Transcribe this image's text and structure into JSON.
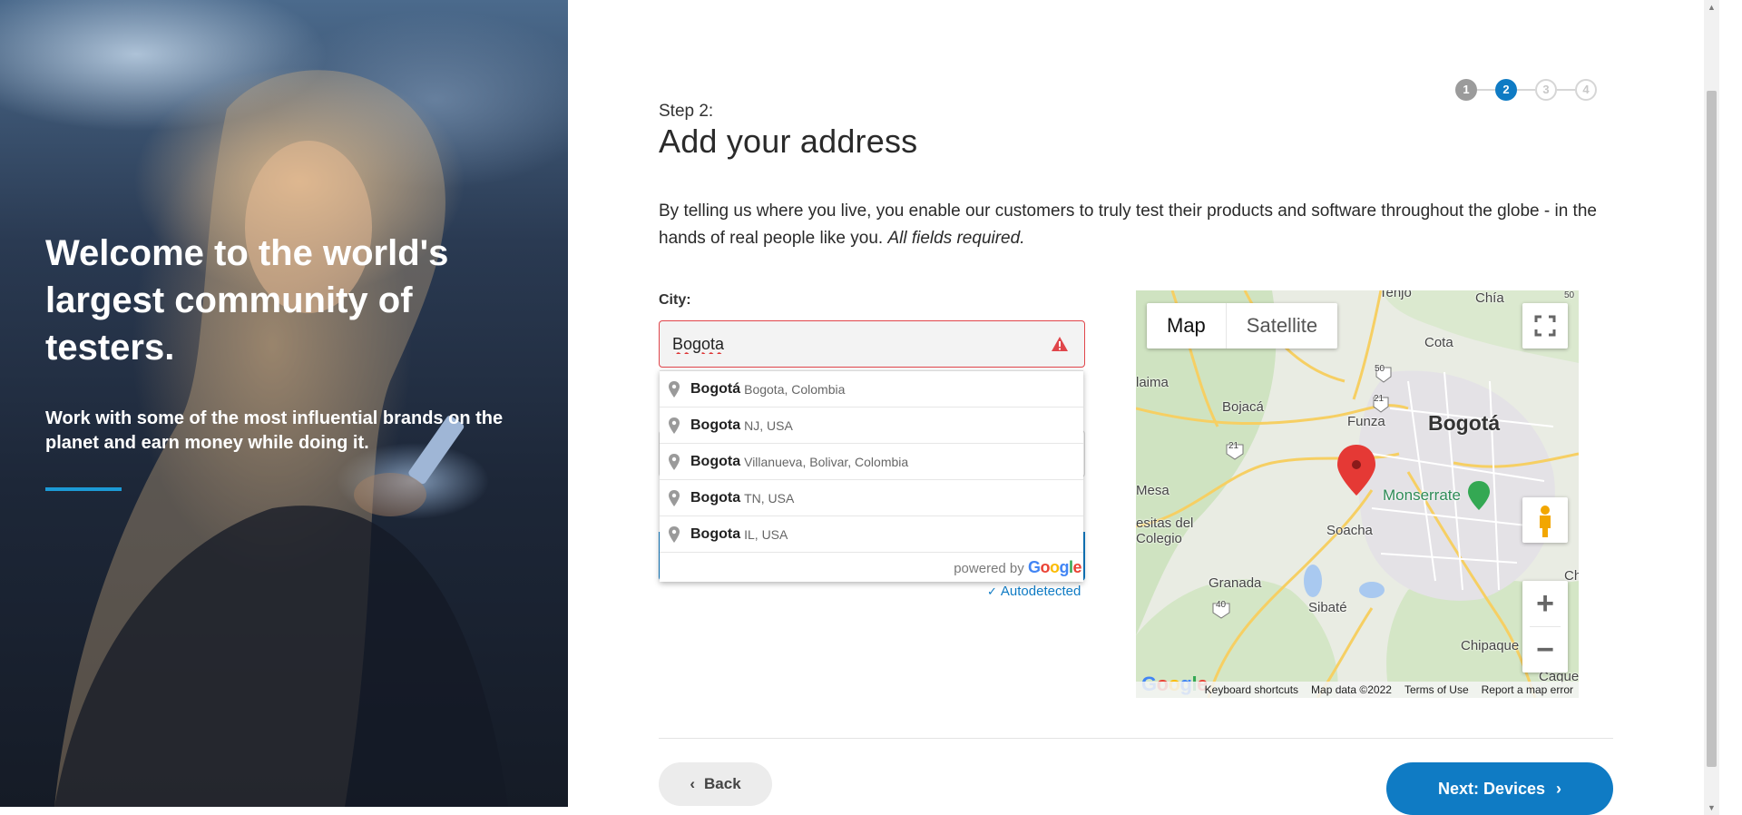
{
  "hero": {
    "title": "Welcome to the world's largest community of testers.",
    "subtitle": "Work with some of the most influential brands on the planet and earn money while doing it."
  },
  "stepper": {
    "steps": [
      "1",
      "2",
      "3",
      "4"
    ],
    "current": 2
  },
  "header": {
    "step_label": "Step 2:",
    "title": "Add your address",
    "intro_text": "By telling us where you live, you enable our customers to truly test their products and software throughout the globe - in the hands of real people like you. ",
    "intro_emphasis": "All fields required."
  },
  "city": {
    "label": "City:",
    "value": "Bogota",
    "error": true
  },
  "autocomplete": {
    "items": [
      {
        "main": "Bogotá",
        "secondary": "Bogota, Colombia"
      },
      {
        "main": "Bogota",
        "secondary": "NJ, USA"
      },
      {
        "main": "Bogota",
        "secondary": "Villanueva, Bolivar, Colombia"
      },
      {
        "main": "Bogota",
        "secondary": "TN, USA"
      },
      {
        "main": "Bogota",
        "secondary": "IL, USA"
      }
    ],
    "powered_by": "powered by",
    "google": "Google"
  },
  "autodetected": "Autodetected",
  "map": {
    "type_buttons": {
      "map": "Map",
      "satellite": "Satellite"
    },
    "selected_type": "Map",
    "labels": {
      "bogota": "Bogotá",
      "monserrate": "Monserrate",
      "funza": "Funza",
      "bojaca": "Bojacá",
      "soacha": "Soacha",
      "granada": "Granada",
      "sibate": "Sibaté",
      "chipaque": "Chipaque",
      "cota": "Cota",
      "chia": "Chía",
      "tenjo": "Tenjo",
      "mesa": "Mesa",
      "colegio": "esitas del\nColegio",
      "alaima": "laima",
      "caqueza": "Cáque",
      "ch": "Ch",
      "r50": "50",
      "r21a": "21",
      "r21b": "21",
      "r40": "40",
      "r50b": "50"
    },
    "footer": {
      "keyboard": "Keyboard shortcuts",
      "data": "Map data ©2022",
      "terms": "Terms of Use",
      "report": "Report a map error"
    },
    "logo": "Google"
  },
  "nav": {
    "back": "Back",
    "next": "Next: Devices"
  },
  "colors": {
    "accent": "#0f7bc4",
    "error": "#e0454a",
    "highlight_rule": "#1c9ad6"
  }
}
